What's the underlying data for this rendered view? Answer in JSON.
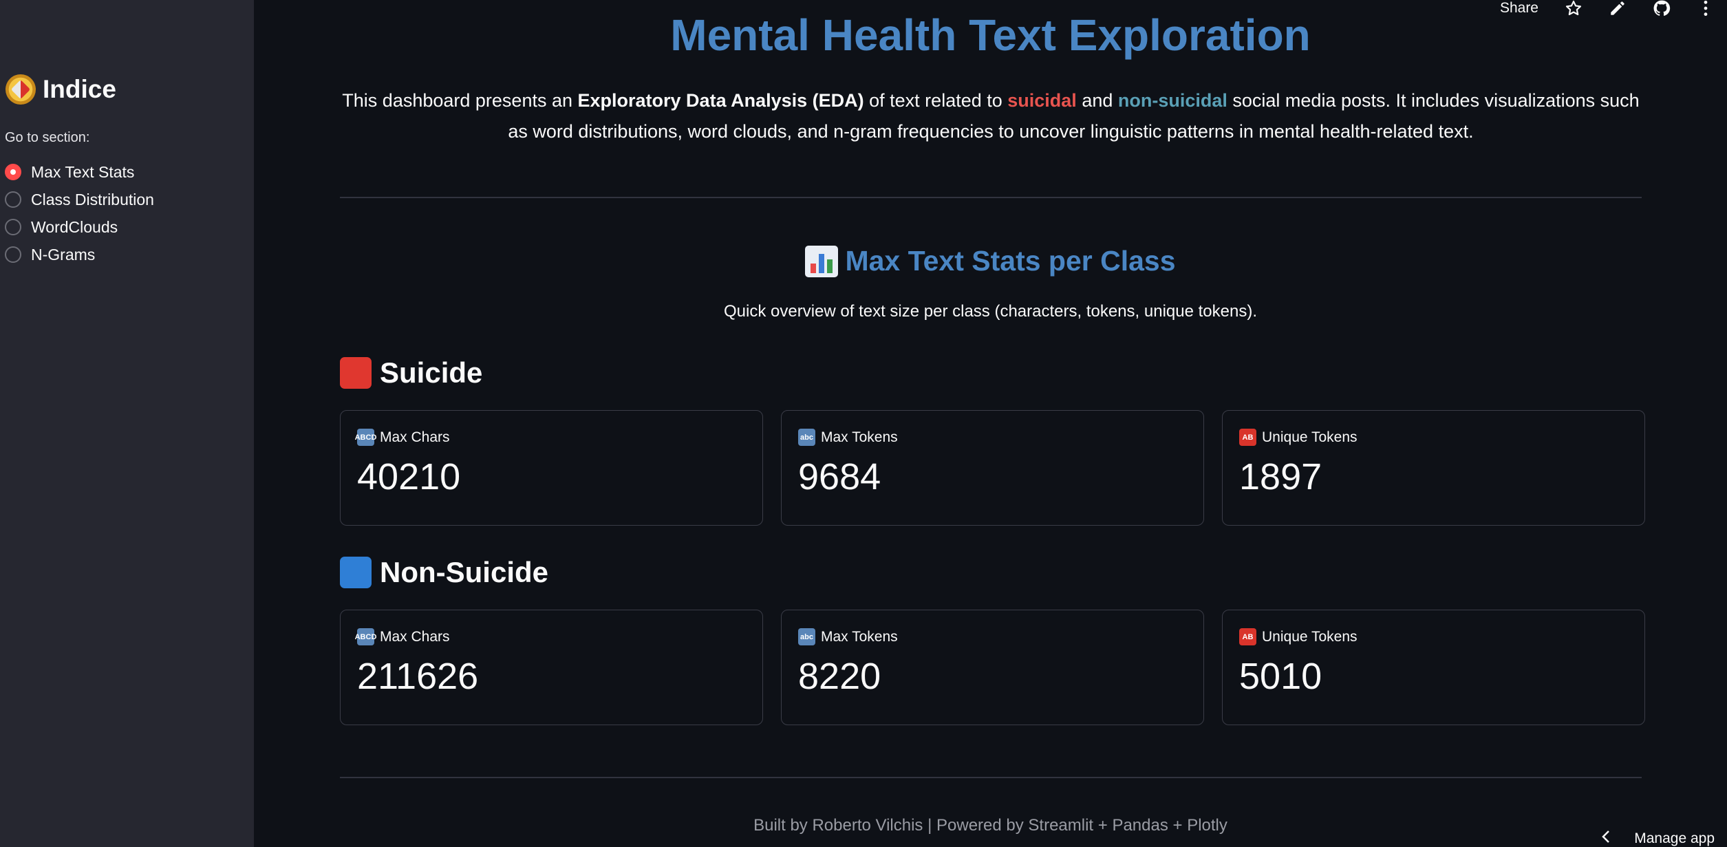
{
  "sidebar": {
    "title": "Indice",
    "title_icon": "compass-icon",
    "nav_label": "Go to section:",
    "items": [
      {
        "label": "Max Text Stats",
        "selected": true
      },
      {
        "label": "Class Distribution",
        "selected": false
      },
      {
        "label": "WordClouds",
        "selected": false
      },
      {
        "label": "N-Grams",
        "selected": false
      }
    ]
  },
  "toolbar": {
    "share_label": "Share",
    "icons": [
      "star-icon",
      "edit-pencil-icon",
      "github-icon",
      "more-vertical-icon"
    ]
  },
  "main": {
    "title": "Mental Health Text Exploration",
    "intro": {
      "part1": "This dashboard presents an ",
      "bold": "Exploratory Data Analysis (EDA)",
      "part2": " of text related to ",
      "suicidal": "suicidal",
      "part3": " and ",
      "non_suicidal": "non-suicidal",
      "part4": " social media posts. It includes visualizations such as word distributions, word clouds, and n-gram frequencies to uncover linguistic patterns in mental health-related text."
    },
    "section_title": "Max Text Stats per Class",
    "section_subtitle": "Quick overview of text size per class (characters, tokens, unique tokens).",
    "classes": [
      {
        "name": "Suicide",
        "color": "#e0372f",
        "metrics": [
          {
            "label": "Max Chars",
            "value": "40210",
            "icon": "abcd-input-icon"
          },
          {
            "label": "Max Tokens",
            "value": "9684",
            "icon": "abc-input-icon"
          },
          {
            "label": "Unique Tokens",
            "value": "1897",
            "icon": "ab-button-icon"
          }
        ]
      },
      {
        "name": "Non-Suicide",
        "color": "#2f7fd6",
        "metrics": [
          {
            "label": "Max Chars",
            "value": "211626",
            "icon": "abcd-input-icon"
          },
          {
            "label": "Max Tokens",
            "value": "8220",
            "icon": "abc-input-icon"
          },
          {
            "label": "Unique Tokens",
            "value": "5010",
            "icon": "ab-button-icon"
          }
        ]
      }
    ],
    "footer": "Built by Roberto Vilchis | Powered by Streamlit + Pandas + Plotly"
  },
  "manage_app": {
    "label": "Manage app"
  },
  "colors": {
    "background": "#0e1117",
    "sidebar": "#262730",
    "title_blue": "#4a86c4",
    "accent_red": "#ff4b4b",
    "suicidal_text": "#e8544f",
    "non_suicidal_text": "#5aa0b6"
  }
}
